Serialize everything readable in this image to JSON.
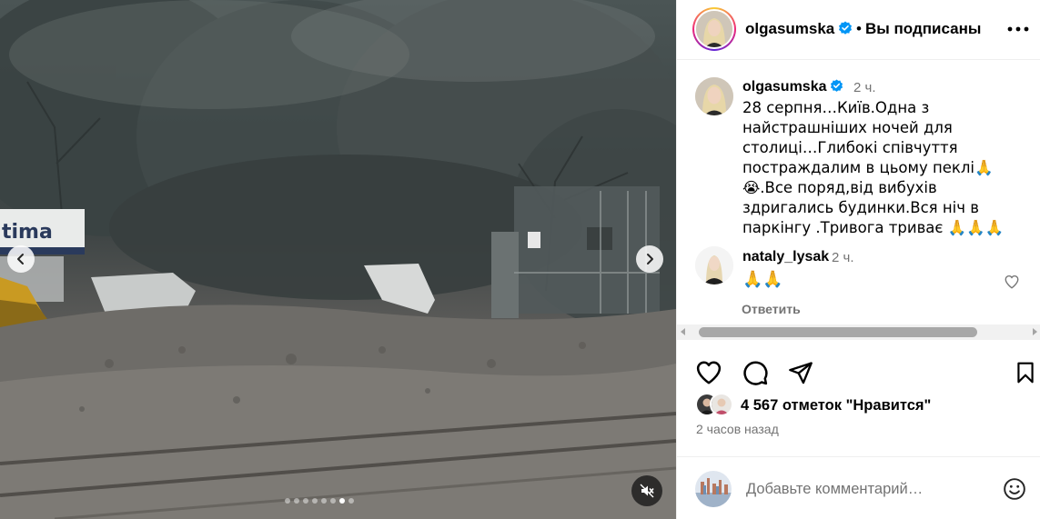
{
  "post": {
    "username": "olgasumska",
    "follow_status": "Вы подписаны",
    "header_separator": "•",
    "caption_time": "2 ч.",
    "caption_text": "28 серпня…Київ.Одна з найстрашніших ночей для столиці…Глибокі співчуття постраждалим в цьому пеклі🙏😭.Все поряд,від вибухів здригались будинки.Вся ніч в паркінгу .Тривога триває 🙏🙏🙏"
  },
  "media": {
    "sign_text": "tima",
    "carousel": {
      "total": 8,
      "active": 7
    }
  },
  "reply": {
    "username": "nataly_lysak",
    "time": "2 ч.",
    "text": "🙏🙏",
    "reply_label": "Ответить"
  },
  "engagement": {
    "likes_text": "4 567 отметок \"Нравится\"",
    "posted_ago": "2 часов назад"
  },
  "composer": {
    "placeholder": "Добавьте комментарий…"
  },
  "icons": {
    "verified": "verified-badge-icon",
    "more": "more-options-icon",
    "like": "heart-icon",
    "comment": "comment-bubble-icon",
    "share": "paper-plane-icon",
    "save": "bookmark-icon",
    "emoji": "emoji-smile-icon",
    "mute": "speaker-muted-icon",
    "prev": "chevron-left-icon",
    "next": "chevron-right-icon"
  },
  "colors": {
    "verified_blue": "#0095f6",
    "secondary_text": "#737373",
    "divider": "#efefef"
  }
}
